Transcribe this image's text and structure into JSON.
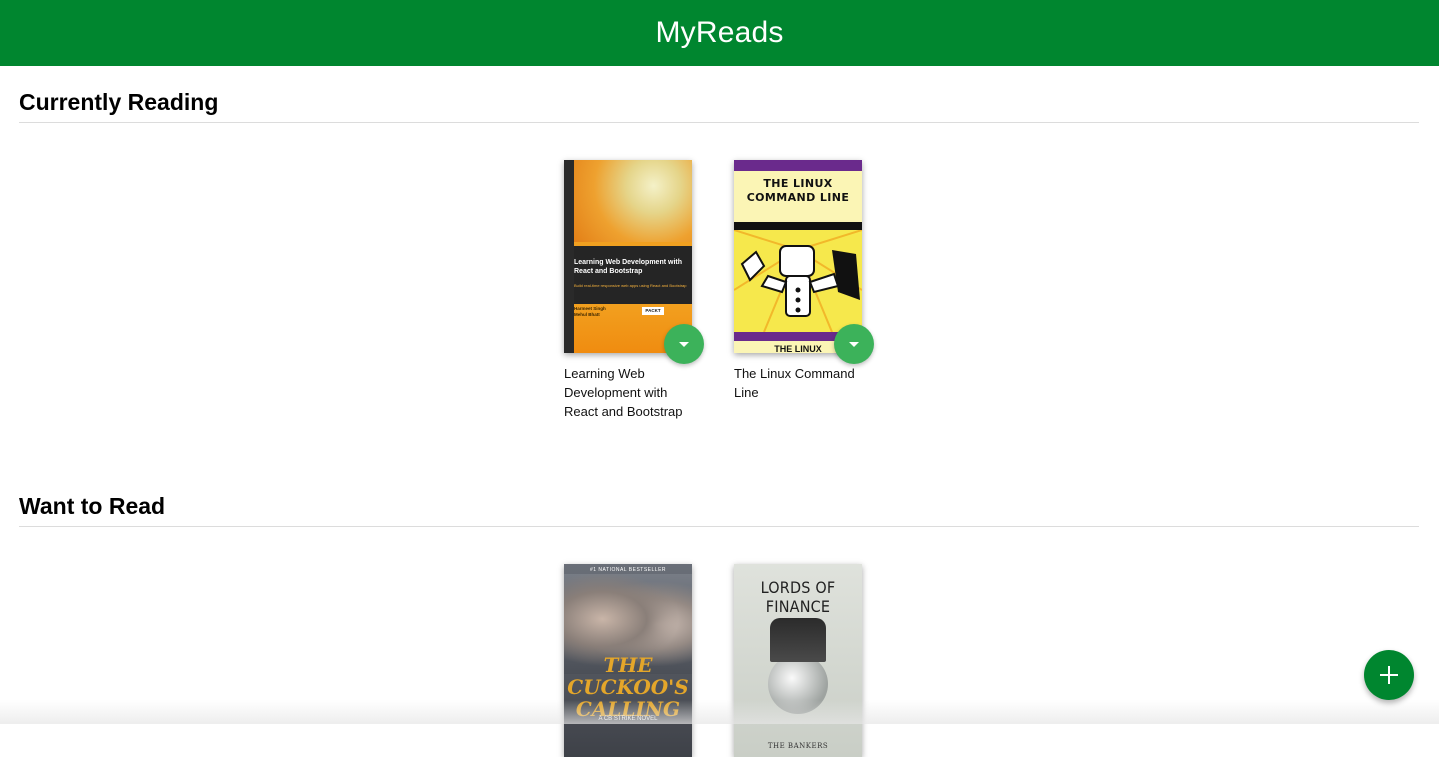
{
  "header": {
    "title": "MyReads"
  },
  "shelves": [
    {
      "title": "Currently Reading",
      "books": [
        {
          "title": "Learning Web Development with React and Bootstrap",
          "cover": {
            "title": "Learning Web Development with React and Bootstrap",
            "subtitle": "Build real-time responsive web apps using React and Bootstrap",
            "authors": "Harmeet Singh\nMehul Bhatt",
            "publisher": "PACKT"
          }
        },
        {
          "title": "The Linux Command Line",
          "cover": {
            "title": "THE LINUX COMMAND LINE",
            "footer": "THE LINUX"
          }
        }
      ]
    },
    {
      "title": "Want to Read",
      "books": [
        {
          "title": "The Cuckoo's Calling",
          "cover": {
            "badge": "#1 NATIONAL BESTSELLER",
            "title": "THE CUCKOO'S CALLING",
            "subtitle": "A CB STRIKE NOVEL"
          }
        },
        {
          "title": "Lords of Finance",
          "cover": {
            "title": "LORDS OF FINANCE",
            "subtitle": "THE BANKERS"
          }
        }
      ]
    }
  ],
  "colors": {
    "header": "#00862f",
    "shelf_changer": "#3cb25a",
    "add_button": "#00862f"
  },
  "icons": {
    "shelf_changer": "caret-down-icon",
    "add": "plus-icon"
  }
}
